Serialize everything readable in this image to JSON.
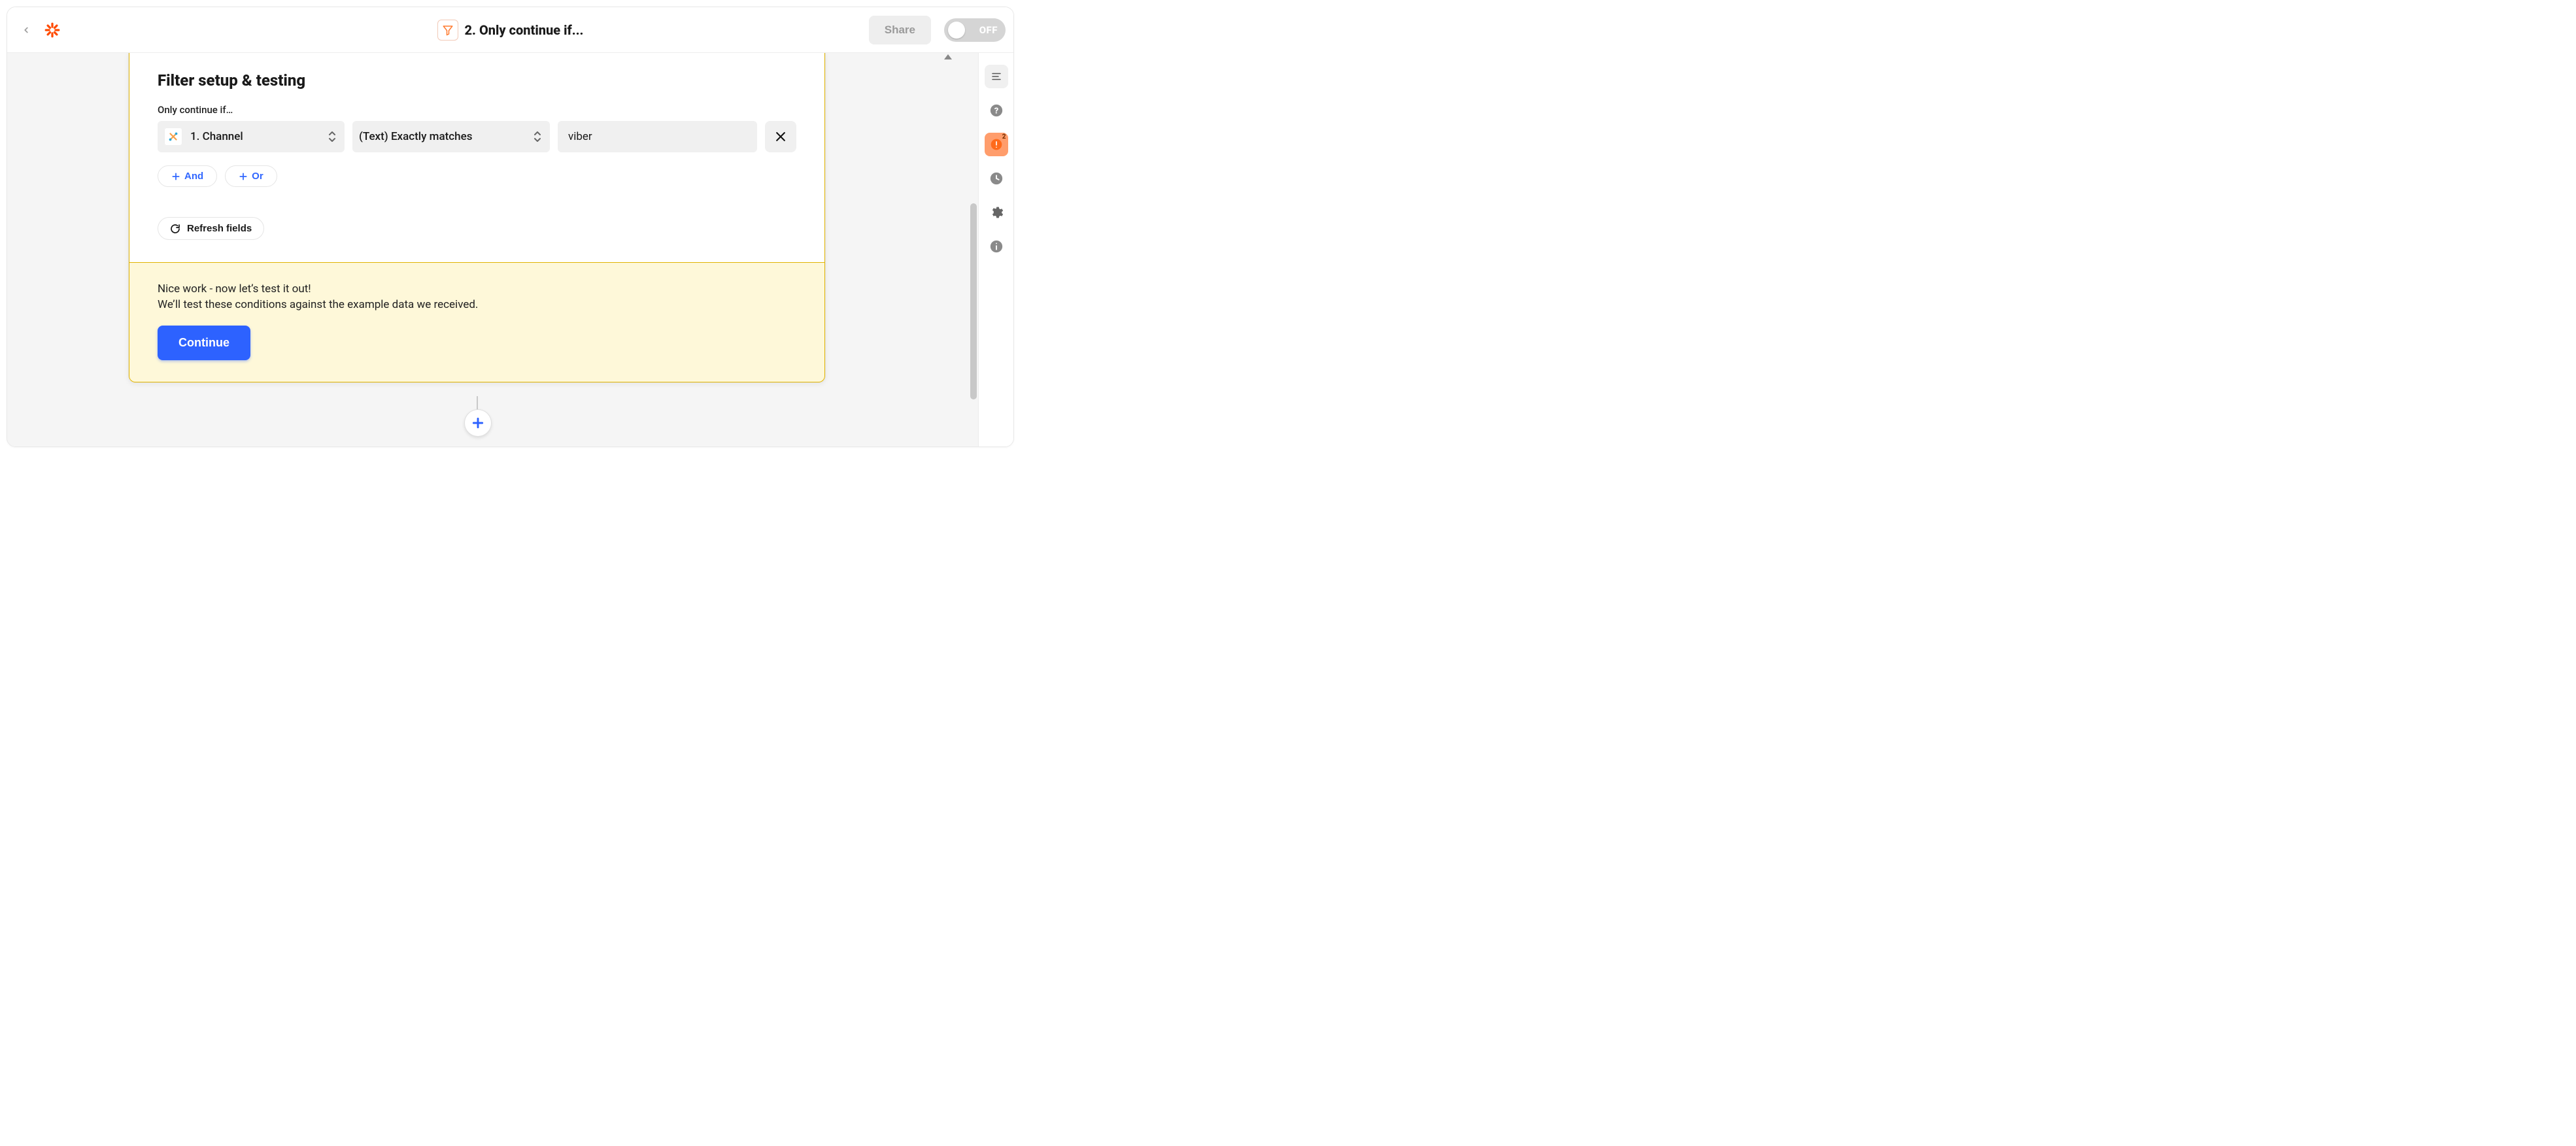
{
  "header": {
    "title": "2. Only continue if...",
    "share_label": "Share",
    "toggle_label": "OFF"
  },
  "editor": {
    "section_title": "Filter setup & testing",
    "hint": "Only continue if…",
    "condition": {
      "field_label": "1. Channel",
      "operator_label": "(Text) Exactly matches",
      "value": "viber"
    },
    "logic": {
      "and_label": "And",
      "or_label": "Or"
    },
    "refresh_label": "Refresh fields"
  },
  "test": {
    "line1": "Nice work - now let’s test it out!",
    "line2": "We’ll test these conditions against the example data we received.",
    "continue_label": "Continue"
  },
  "rail": {
    "alert_count": "2"
  }
}
